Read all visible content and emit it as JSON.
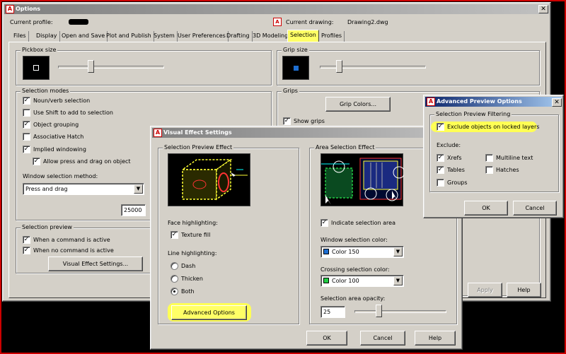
{
  "options_window": {
    "title": "Options",
    "current_profile_label": "Current profile:",
    "current_drawing_label": "Current drawing:",
    "current_drawing_value": "Drawing2.dwg",
    "tabs": [
      "Files",
      "Display",
      "Open and Save",
      "Plot and Publish",
      "System",
      "User Preferences",
      "Drafting",
      "3D Modeling",
      "Selection",
      "Profiles"
    ],
    "selected_tab": "Selection",
    "pickbox_label": "Pickbox size",
    "grip_size_label": "Grip size",
    "selection_modes_label": "Selection modes",
    "selection_modes": [
      {
        "label": "Noun/verb selection",
        "checked": true
      },
      {
        "label": "Use Shift to add to selection",
        "checked": false
      },
      {
        "label": "Object grouping",
        "checked": true
      },
      {
        "label": "Associative Hatch",
        "checked": false
      },
      {
        "label": "Implied windowing",
        "checked": true
      },
      {
        "label": "Allow press and drag on object",
        "checked": true
      }
    ],
    "window_method_label": "Window selection method:",
    "window_method_value": "Press and drag",
    "limit_value": "25000",
    "selection_preview_label": "Selection preview",
    "preview_options": [
      {
        "label": "When a command is active",
        "checked": true
      },
      {
        "label": "When no command is active",
        "checked": true
      }
    ],
    "visual_effect_button": "Visual Effect Settings...",
    "grips_label": "Grips",
    "grip_colors_button": "Grip Colors...",
    "show_grips_label": "Show grips",
    "apply_button": "Apply",
    "help_button": "Help"
  },
  "visual_effect_dialog": {
    "title": "Visual Effect Settings",
    "selection_preview_effect_label": "Selection Preview Effect",
    "face_highlighting_label": "Face highlighting:",
    "texture_fill_label": "Texture fill",
    "line_highlighting_label": "Line highlighting:",
    "line_options": [
      {
        "label": "Dash",
        "selected": false
      },
      {
        "label": "Thicken",
        "selected": false
      },
      {
        "label": "Both",
        "selected": true
      }
    ],
    "advanced_options_button": "Advanced Options",
    "area_selection_effect_label": "Area Selection Effect",
    "indicate_selection_area_label": "Indicate selection area",
    "window_color_label": "Window selection color:",
    "window_color_value": "Color 150",
    "window_color_swatch": "#1e6ed0",
    "crossing_color_label": "Crossing selection color:",
    "crossing_color_value": "Color 100",
    "crossing_color_swatch": "#22cc44",
    "opacity_label": "Selection area opacity:",
    "opacity_value": "25",
    "ok_button": "OK",
    "cancel_button": "Cancel",
    "help_button": "Help"
  },
  "advanced_dialog": {
    "title": "Advanced Preview Options",
    "filtering_label": "Selection Preview Filtering",
    "exclude_locked_label": "Exclude objects on locked layers",
    "exclude_label": "Exclude:",
    "exclude_items": [
      {
        "label": "Xrefs",
        "checked": true
      },
      {
        "label": "Multiline text",
        "checked": false
      },
      {
        "label": "Tables",
        "checked": true
      },
      {
        "label": "Hatches",
        "checked": false
      },
      {
        "label": "Groups",
        "checked": false
      }
    ],
    "ok_button": "OK",
    "cancel_button": "Cancel"
  },
  "colors": {
    "dialog_bg": "#d4d0c8",
    "active_title": "#0a246a",
    "inactive_title": "#808080",
    "highlight": "#ffff55",
    "outer_border": "#cc0000"
  }
}
